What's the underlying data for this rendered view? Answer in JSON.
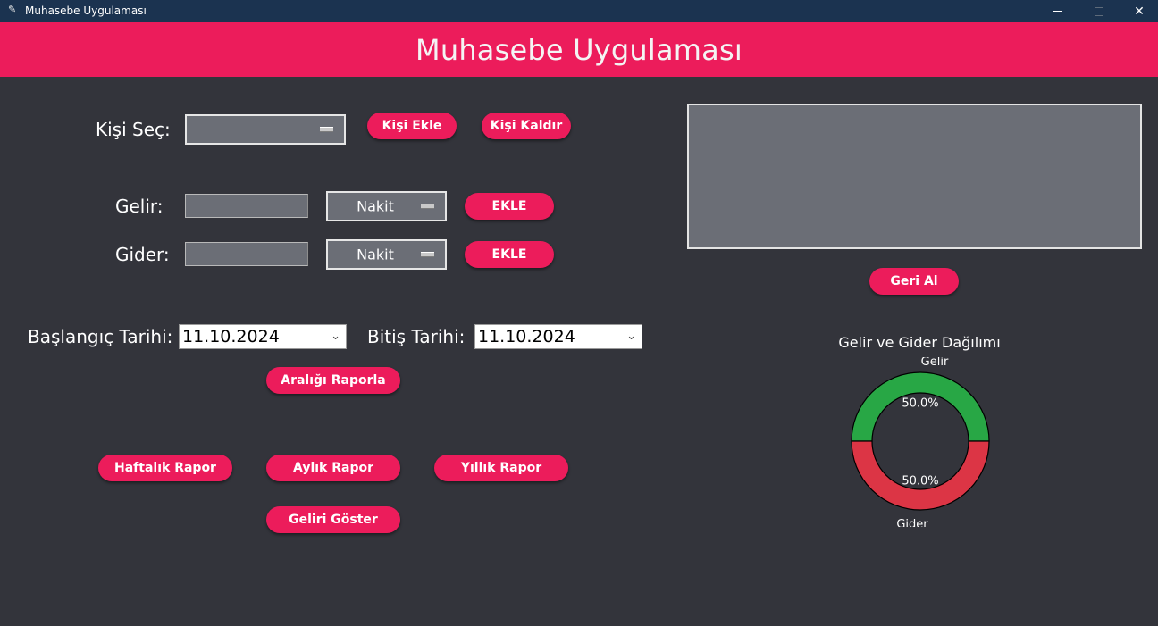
{
  "window": {
    "title": "Muhasebe Uygulaması"
  },
  "header": {
    "title": "Muhasebe Uygulaması"
  },
  "person": {
    "label": "Kişi Seç:",
    "selected": "",
    "add_button": "Kişi Ekle",
    "remove_button": "Kişi Kaldır"
  },
  "income": {
    "label": "Gelir:",
    "amount": "",
    "method": "Nakit",
    "add_button": "EKLE"
  },
  "expense": {
    "label": "Gider:",
    "amount": "",
    "method": "Nakit",
    "add_button": "EKLE"
  },
  "dates": {
    "start_label": "Başlangıç Tarihi:",
    "start_value": "11.10.2024",
    "end_label": "Bitiş Tarihi:",
    "end_value": "11.10.2024",
    "range_button": "Aralığı Raporla"
  },
  "reports": {
    "weekly": "Haftalık Rapor",
    "monthly": "Aylık Rapor",
    "yearly": "Yıllık Rapor",
    "show_income": "Geliri Göster"
  },
  "undo_button": "Geri Al",
  "colors": {
    "accent": "#ec1c5b",
    "background": "#33343b",
    "titlebar": "#1b3350",
    "income": "#28a745",
    "expense": "#dc3545"
  },
  "chart_data": {
    "type": "pie",
    "title": "Gelir ve Gider Dağılımı",
    "categories": [
      "Gelir",
      "Gider"
    ],
    "values": [
      50.0,
      50.0
    ],
    "labels": [
      "50.0%",
      "50.0%"
    ],
    "colors": [
      "#28a745",
      "#dc3545"
    ],
    "style": "donut"
  }
}
